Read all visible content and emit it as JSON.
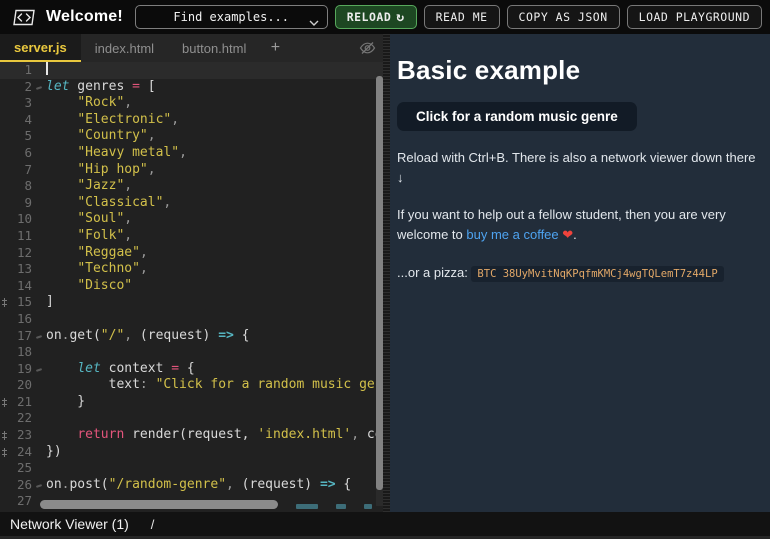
{
  "topbar": {
    "logo_icon": "code-brackets",
    "title": "Welcome!",
    "find_select": {
      "value": "Find examples...",
      "chevron_icon": "chevron-down"
    },
    "buttons": {
      "reload": "RELOAD",
      "reload_icon": "↻",
      "readme": "READ ME",
      "copy_json": "COPY AS JSON",
      "load_playground": "LOAD PLAYGROUND"
    }
  },
  "tabs": [
    {
      "label": "server.js",
      "active": true
    },
    {
      "label": "index.html",
      "active": false
    },
    {
      "label": "button.html",
      "active": false
    }
  ],
  "tabs_add": "+",
  "tabbar_icons": {
    "hide_editor": "eye-off"
  },
  "editor": {
    "language": "javascript",
    "lines": [
      {
        "n": 1,
        "cur": true,
        "seg": []
      },
      {
        "n": 2,
        "fold": true,
        "seg": [
          [
            "k",
            "let"
          ],
          [
            "p",
            " genres "
          ],
          [
            "o",
            "="
          ],
          [
            "p",
            " ["
          ]
        ]
      },
      {
        "n": 3,
        "seg": [
          [
            "p",
            "    "
          ],
          [
            "s",
            "\"Rock\""
          ],
          [
            "g",
            ","
          ]
        ]
      },
      {
        "n": 4,
        "seg": [
          [
            "p",
            "    "
          ],
          [
            "s",
            "\"Electronic\""
          ],
          [
            "g",
            ","
          ]
        ]
      },
      {
        "n": 5,
        "seg": [
          [
            "p",
            "    "
          ],
          [
            "s",
            "\"Country\""
          ],
          [
            "g",
            ","
          ]
        ]
      },
      {
        "n": 6,
        "seg": [
          [
            "p",
            "    "
          ],
          [
            "s",
            "\"Heavy metal\""
          ],
          [
            "g",
            ","
          ]
        ]
      },
      {
        "n": 7,
        "seg": [
          [
            "p",
            "    "
          ],
          [
            "s",
            "\"Hip hop\""
          ],
          [
            "g",
            ","
          ]
        ]
      },
      {
        "n": 8,
        "seg": [
          [
            "p",
            "    "
          ],
          [
            "s",
            "\"Jazz\""
          ],
          [
            "g",
            ","
          ]
        ]
      },
      {
        "n": 9,
        "seg": [
          [
            "p",
            "    "
          ],
          [
            "s",
            "\"Classical\""
          ],
          [
            "g",
            ","
          ]
        ]
      },
      {
        "n": 10,
        "seg": [
          [
            "p",
            "    "
          ],
          [
            "s",
            "\"Soul\""
          ],
          [
            "g",
            ","
          ]
        ]
      },
      {
        "n": 11,
        "seg": [
          [
            "p",
            "    "
          ],
          [
            "s",
            "\"Folk\""
          ],
          [
            "g",
            ","
          ]
        ]
      },
      {
        "n": 12,
        "seg": [
          [
            "p",
            "    "
          ],
          [
            "s",
            "\"Reggae\""
          ],
          [
            "g",
            ","
          ]
        ]
      },
      {
        "n": 13,
        "seg": [
          [
            "p",
            "    "
          ],
          [
            "s",
            "\"Techno\""
          ],
          [
            "g",
            ","
          ]
        ]
      },
      {
        "n": 14,
        "seg": [
          [
            "p",
            "    "
          ],
          [
            "s",
            "\"Disco\""
          ]
        ]
      },
      {
        "n": 15,
        "mark": true,
        "seg": [
          [
            "p",
            "]"
          ]
        ]
      },
      {
        "n": 16,
        "seg": []
      },
      {
        "n": 17,
        "fold": true,
        "seg": [
          [
            "p",
            "on"
          ],
          [
            "g",
            "."
          ],
          [
            "p",
            "get("
          ],
          [
            "s",
            "\"/\""
          ],
          [
            "g",
            ","
          ],
          [
            "p",
            " (request) "
          ],
          [
            "a",
            "=>"
          ],
          [
            "p",
            " {"
          ]
        ]
      },
      {
        "n": 18,
        "seg": []
      },
      {
        "n": 19,
        "fold": true,
        "seg": [
          [
            "p",
            "    "
          ],
          [
            "k",
            "let"
          ],
          [
            "p",
            " context "
          ],
          [
            "o",
            "="
          ],
          [
            "p",
            " {"
          ]
        ]
      },
      {
        "n": 20,
        "seg": [
          [
            "p",
            "        text"
          ],
          [
            "g",
            ":"
          ],
          [
            "p",
            " "
          ],
          [
            "s",
            "\"Click for a random music genre\""
          ]
        ]
      },
      {
        "n": 21,
        "mark": true,
        "seg": [
          [
            "p",
            "    }"
          ]
        ]
      },
      {
        "n": 22,
        "seg": []
      },
      {
        "n": 23,
        "mark": true,
        "seg": [
          [
            "p",
            "    "
          ],
          [
            "o",
            "return"
          ],
          [
            "p",
            " render(request, "
          ],
          [
            "s",
            "'index.html'"
          ],
          [
            "g",
            ","
          ],
          [
            "p",
            " context)"
          ]
        ]
      },
      {
        "n": 24,
        "mark": true,
        "seg": [
          [
            "p",
            "})"
          ]
        ]
      },
      {
        "n": 25,
        "seg": []
      },
      {
        "n": 26,
        "fold": true,
        "seg": [
          [
            "p",
            "on"
          ],
          [
            "g",
            "."
          ],
          [
            "p",
            "post("
          ],
          [
            "s",
            "\"/random-genre\""
          ],
          [
            "g",
            ","
          ],
          [
            "p",
            " (request) "
          ],
          [
            "a",
            "=>"
          ],
          [
            "p",
            " {"
          ]
        ]
      },
      {
        "n": 27,
        "seg": []
      }
    ]
  },
  "preview": {
    "heading": "Basic example",
    "button_label": "Click for a random music genre",
    "p1": "Reload with Ctrl+B. There is also a network viewer down there ↓",
    "p2_pre": "If you want to help out a fellow student, then you are very welcome to ",
    "p2_link": "buy me a coffee",
    "p2_heart": " ❤",
    "p2_post": ".",
    "p3_pre": "...or a pizza: ",
    "p3_code": "BTC 38UyMvitNqKPqfmKMCj4wgTQLemT7z44LP"
  },
  "statusbar": {
    "label": "Network Viewer (1)",
    "path": "/"
  },
  "colors": {
    "accent_yellow": "#e9c83e",
    "reload_green": "#57a85c",
    "link_blue": "#4ea3f0",
    "string_yellow": "#d2c04a",
    "keyword_cyan": "#56b6c2",
    "operator_pink": "#e4557c",
    "preview_bg": "#222d3a",
    "btc_text": "#e2a868"
  }
}
